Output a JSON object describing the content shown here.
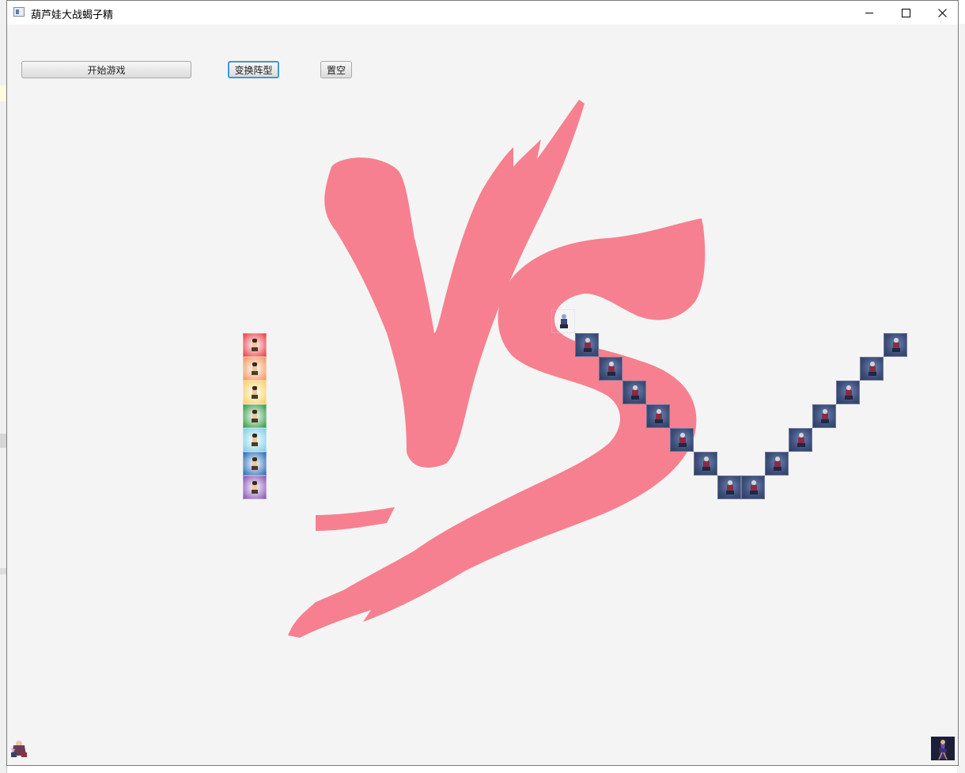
{
  "window": {
    "title": "葫芦娃大战蝎子精"
  },
  "controls": {
    "start_label": "开始游戏",
    "formation_label": "变换阵型",
    "clear_label": "置空"
  },
  "icons": {
    "app": "app-window-icon",
    "minimize": "minimize-icon",
    "maximize": "maximize-icon",
    "close": "close-icon",
    "logo": "vs-logo"
  },
  "colors": {
    "vs_logo": "#f6808f",
    "window_bg": "#f4f4f4",
    "focus_ring": "#3c9ad6"
  },
  "board": {
    "gourd_brothers": [
      {
        "color": "#e8464b"
      },
      {
        "color": "#f29a62"
      },
      {
        "color": "#f7d166"
      },
      {
        "color": "#3c9d4b"
      },
      {
        "color": "#7fd0e8"
      },
      {
        "color": "#2f6fb8"
      },
      {
        "color": "#8a58b8"
      }
    ],
    "scorpion_formation": "V-shape",
    "scorpion_minion_count": 14
  }
}
